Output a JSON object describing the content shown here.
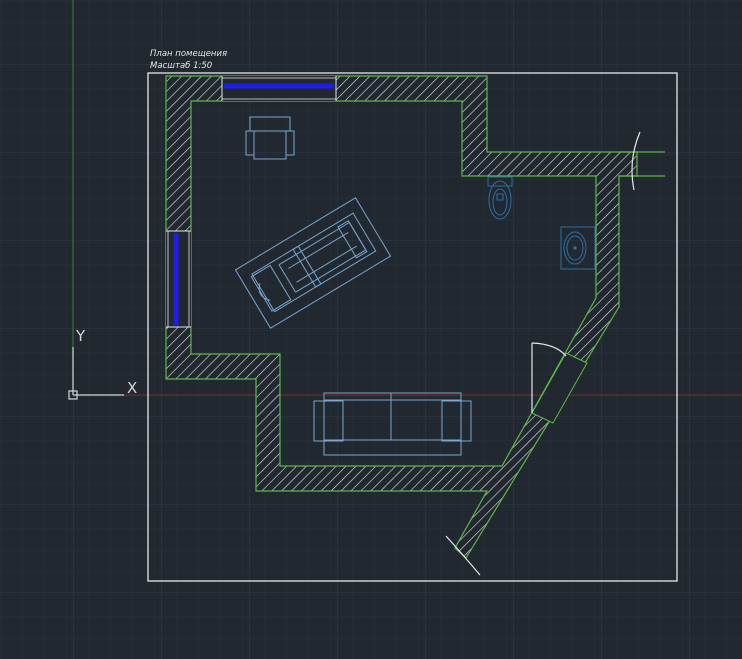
{
  "drawing": {
    "title_line1": "План помещения",
    "title_line2": "Масштаб 1:50"
  },
  "ucs": {
    "x_label": "X",
    "y_label": "Y"
  },
  "colors": {
    "background": "#212830",
    "grid_minor": "#283039",
    "grid_major": "#2f3a47",
    "frame": "#e8e8e8",
    "wall_outline": "#5db848",
    "hatch": "#e6e6e6",
    "window_glass": "#1e1ee6",
    "furniture": "#7aa6cf",
    "plumbing": "#2d6ea5",
    "y_axis_line": "#3e7f2f",
    "x_axis_line": "#7a2a2a",
    "door_arc": "#e8e8e8"
  },
  "icons": {
    "ucs": "ucs-icon",
    "armchair": "armchair-icon",
    "bed": "bed-icon",
    "toilet": "toilet-icon",
    "washbasin": "washbasin-icon",
    "sofa": "sofa-icon"
  }
}
